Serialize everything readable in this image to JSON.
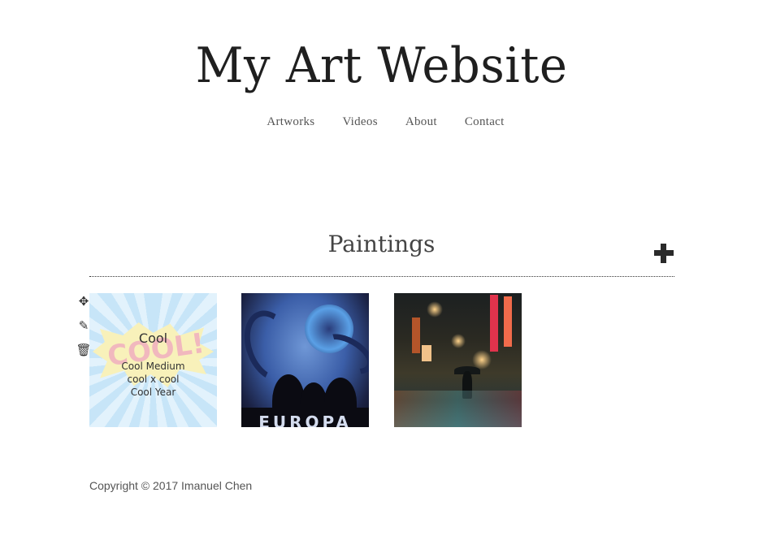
{
  "site": {
    "title": "My Art Website"
  },
  "nav": {
    "items": [
      {
        "label": "Artworks"
      },
      {
        "label": "Videos"
      },
      {
        "label": "About"
      },
      {
        "label": "Contact"
      }
    ]
  },
  "section": {
    "title": "Paintings",
    "add_icon": "plus-icon"
  },
  "tools": {
    "move_icon": "move-icon",
    "edit_icon": "pencil-icon",
    "delete_icon": "trash-icon"
  },
  "artworks": [
    {
      "title": "Cool",
      "medium": "Cool Medium",
      "size": "cool x cool",
      "year": "Cool Year",
      "image_text": "COOL!"
    },
    {
      "image_text": "EUROPA"
    },
    {}
  ],
  "footer": {
    "copyright": "Copyright © 2017 Imanuel Chen"
  }
}
